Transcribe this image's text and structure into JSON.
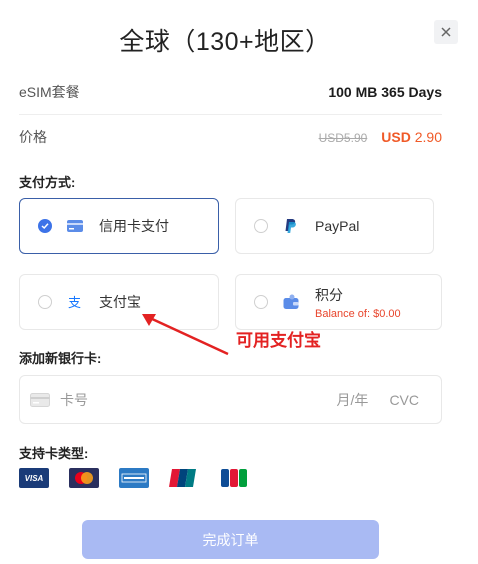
{
  "header": {
    "title": "全球（130+地区）",
    "close_icon": "close-icon"
  },
  "plan": {
    "label": "eSIM套餐",
    "value": "100 MB 365 Days"
  },
  "price": {
    "label": "价格",
    "original": "USD5.90",
    "currency": "USD",
    "amount": "2.90"
  },
  "payment": {
    "title": "支付方式:",
    "methods": [
      {
        "label": "信用卡支付",
        "icon": "credit-card-icon",
        "selected": true
      },
      {
        "label": "PayPal",
        "icon": "paypal-icon",
        "selected": false
      },
      {
        "label": "支付宝",
        "icon": "alipay-icon",
        "selected": false
      },
      {
        "label": "积分",
        "icon": "wallet-icon",
        "balance": "Balance of: $0.00",
        "selected": false
      }
    ]
  },
  "card": {
    "title": "添加新银行卡:",
    "number_placeholder": "卡号",
    "expiry_placeholder": "月/年",
    "cvc_placeholder": "CVC"
  },
  "supported": {
    "title": "支持卡类型:",
    "brands": [
      "VISA",
      "MasterCard",
      "American Express",
      "UnionPay",
      "JCB"
    ]
  },
  "submit": {
    "label": "完成订单"
  },
  "annotation": {
    "text": "可用支付宝",
    "color": "#e32222"
  },
  "colors": {
    "accent": "#3d73e8",
    "price": "#f05a28",
    "button": "#a9baf3"
  }
}
